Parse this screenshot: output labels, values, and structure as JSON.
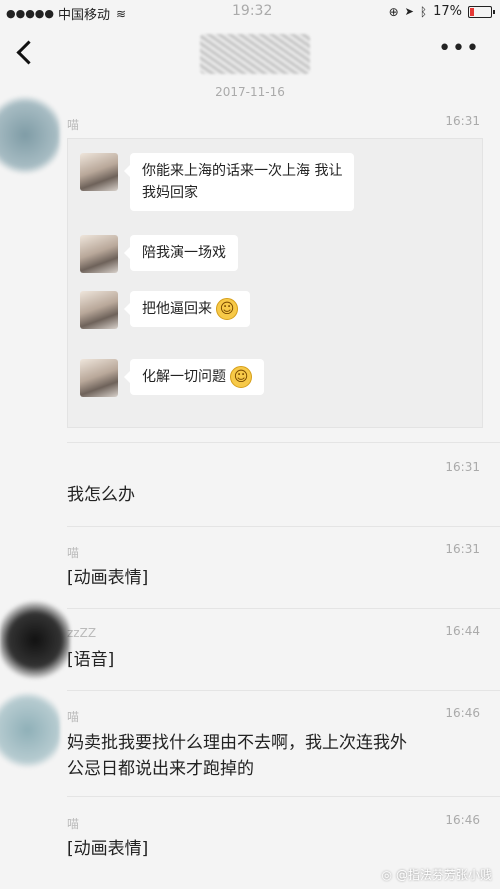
{
  "status_bar": {
    "signal": "●●●●●",
    "carrier": "中国移动",
    "time": "19:32",
    "battery": "17%"
  },
  "nav": {
    "more": "•••"
  },
  "date": "2017-11-16",
  "messages": [
    {
      "sender": "喵",
      "time": "16:31"
    },
    {
      "sender": "",
      "time": "16:31",
      "text": "我怎么办"
    },
    {
      "sender": "喵",
      "time": "16:31",
      "text": "[动画表情]"
    },
    {
      "sender": "zzZZ",
      "time": "16:44",
      "text": "[语音]"
    },
    {
      "sender": "喵",
      "time": "16:46",
      "text_line1": "妈卖批我要找什么理由不去啊，我上次连我外",
      "text_line2": "公忌日都说出来才跑掉的"
    },
    {
      "sender": "喵",
      "time": "16:46",
      "text": "[动画表情]"
    }
  ],
  "record": {
    "items": [
      {
        "line1": "你能来上海的话来一次上海 我让",
        "line2": "我妈回家"
      },
      {
        "line1": "陪我演一场戏"
      },
      {
        "line1": "把他逼回来",
        "emoji": "☺"
      },
      {
        "line1": "化解一切问题",
        "emoji": "☺"
      }
    ]
  },
  "watermark": "@指法芬芳张小贱"
}
